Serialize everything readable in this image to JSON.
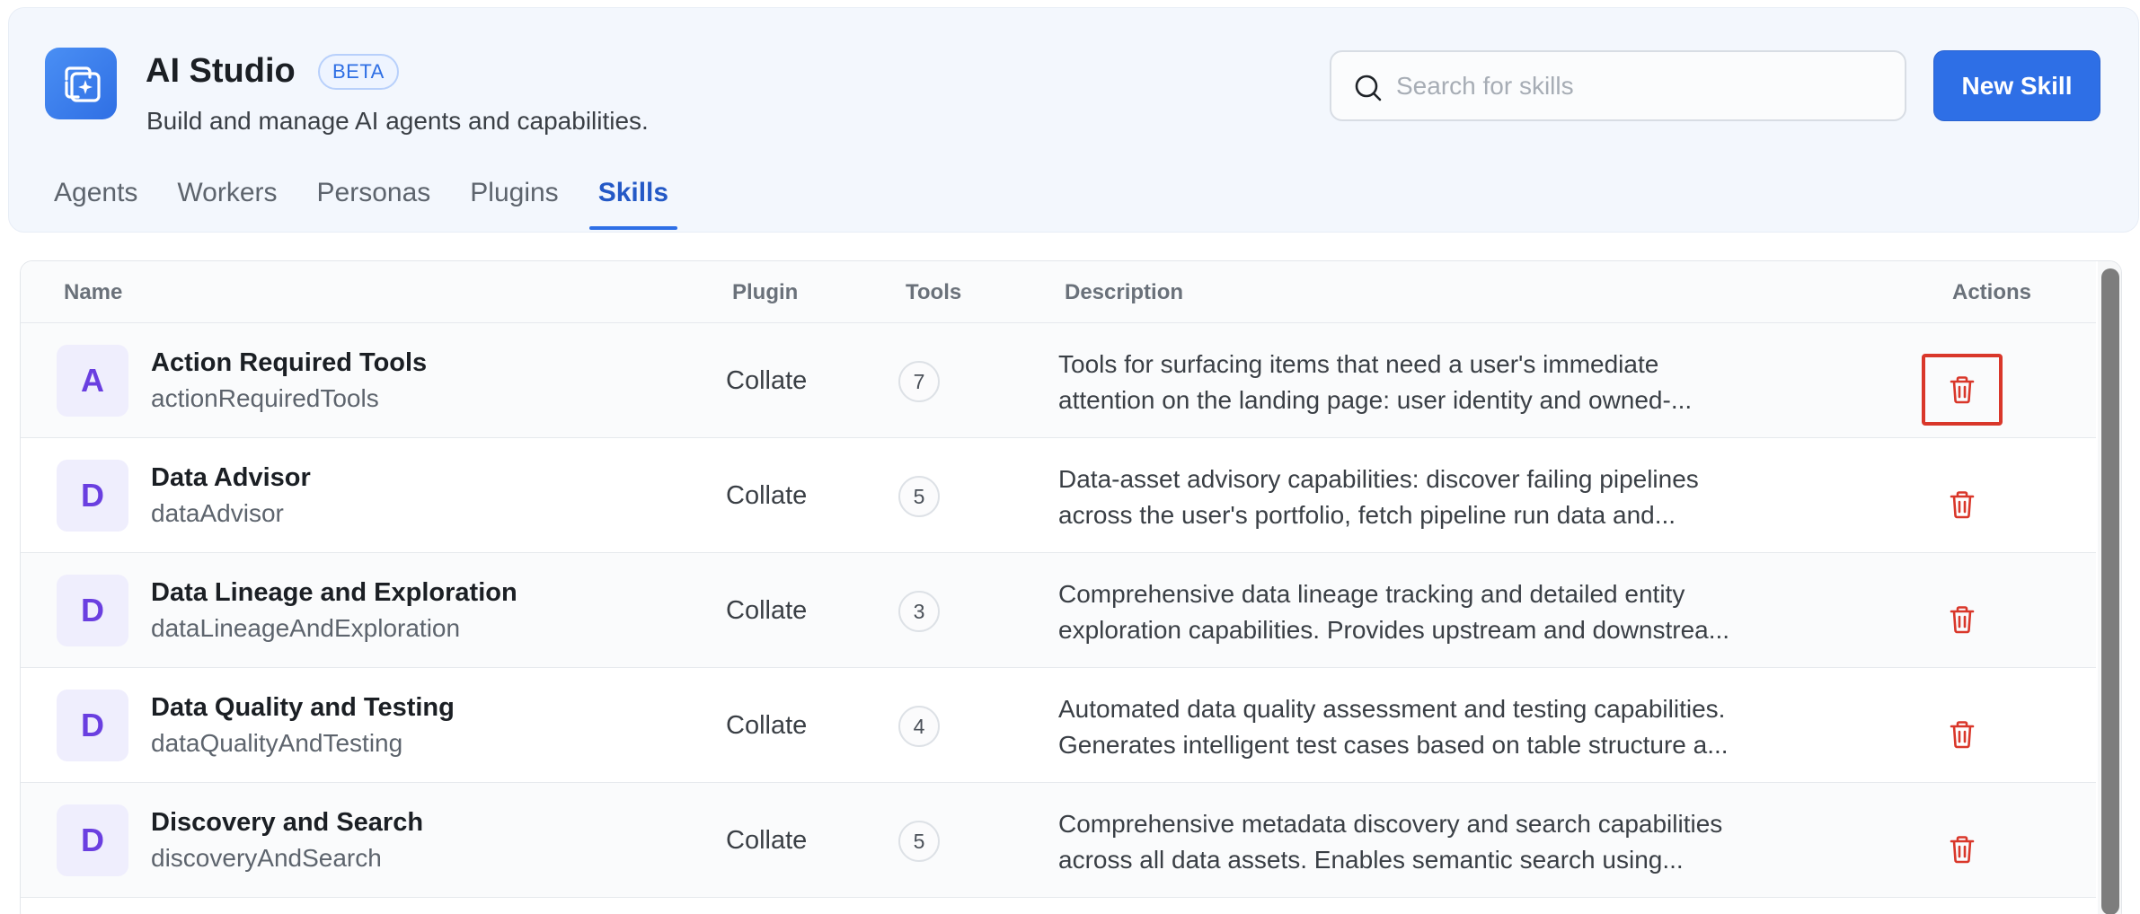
{
  "app": {
    "title": "AI Studio",
    "badge": "BETA",
    "subtitle": "Build and manage AI agents and capabilities.",
    "logo_icon": "ai-sparkle-icon",
    "accent_color": "#2e6fe6"
  },
  "search": {
    "placeholder": "Search for skills",
    "value": ""
  },
  "toolbar": {
    "new_skill_label": "New Skill"
  },
  "tabs": [
    {
      "label": "Agents",
      "active": false
    },
    {
      "label": "Workers",
      "active": false
    },
    {
      "label": "Personas",
      "active": false
    },
    {
      "label": "Plugins",
      "active": false
    },
    {
      "label": "Skills",
      "active": true
    }
  ],
  "table": {
    "columns": {
      "name": "Name",
      "plugin": "Plugin",
      "tools": "Tools",
      "description": "Description",
      "actions": "Actions"
    },
    "rows": [
      {
        "initial": "A",
        "name": "Action Required Tools",
        "id": "actionRequiredTools",
        "plugin": "Collate",
        "tools": "7",
        "desc1": "Tools for surfacing items that need a user's immediate",
        "desc2": "attention on the landing page: user identity and owned-...",
        "delete_focused": true
      },
      {
        "initial": "D",
        "name": "Data Advisor",
        "id": "dataAdvisor",
        "plugin": "Collate",
        "tools": "5",
        "desc1": "Data-asset advisory capabilities: discover failing pipelines",
        "desc2": "across the user's portfolio, fetch pipeline run data and...",
        "delete_focused": false
      },
      {
        "initial": "D",
        "name": "Data Lineage and Exploration",
        "id": "dataLineageAndExploration",
        "plugin": "Collate",
        "tools": "3",
        "desc1": "Comprehensive data lineage tracking and detailed entity",
        "desc2": "exploration capabilities. Provides upstream and downstrea...",
        "delete_focused": false
      },
      {
        "initial": "D",
        "name": "Data Quality and Testing",
        "id": "dataQualityAndTesting",
        "plugin": "Collate",
        "tools": "4",
        "desc1": "Automated data quality assessment and testing capabilities.",
        "desc2": "Generates intelligent test cases based on table structure a...",
        "delete_focused": false
      },
      {
        "initial": "D",
        "name": "Discovery and Search",
        "id": "discoveryAndSearch",
        "plugin": "Collate",
        "tools": "5",
        "desc1": "Comprehensive metadata discovery and search capabilities",
        "desc2": "across all data assets. Enables semantic search using...",
        "delete_focused": false
      }
    ],
    "delete_icon_color": "#d9372a"
  }
}
